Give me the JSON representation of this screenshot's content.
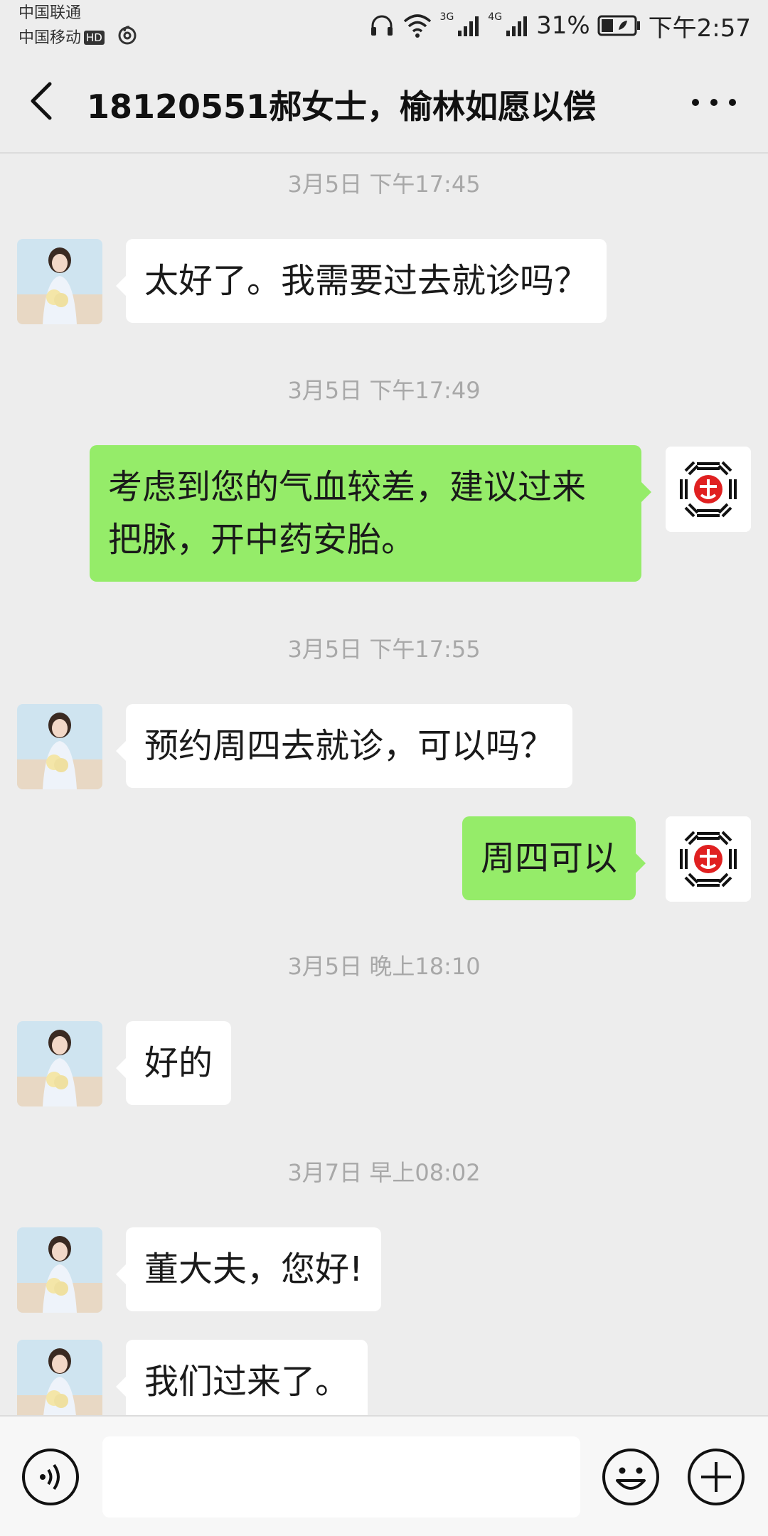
{
  "status_bar": {
    "carrier_1": "中国联通",
    "carrier_2": "中国移动",
    "hd_badge": "HD",
    "network_3g": "3G",
    "network_4g": "4G",
    "battery_percent": "31%",
    "time": "下午2:57"
  },
  "header": {
    "back_icon": "chevron-left-icon",
    "title": "18120551郝女士，榆林如愿以偿",
    "more_icon": "more-dots-icon"
  },
  "messages": [
    {
      "type": "time",
      "text": "3月5日 下午17:45"
    },
    {
      "type": "in",
      "text": "太好了。我需要过去就诊吗？"
    },
    {
      "type": "time",
      "text": "3月5日 下午17:49"
    },
    {
      "type": "out",
      "lines": [
        "考虑到您的气血较差，建议过来",
        "把脉，开中药安胎。"
      ]
    },
    {
      "type": "time",
      "text": "3月5日 下午17:55"
    },
    {
      "type": "in",
      "text": "预约周四去就诊，可以吗？"
    },
    {
      "type": "out",
      "text": "周四可以"
    },
    {
      "type": "time",
      "text": "3月5日 晚上18:10"
    },
    {
      "type": "in",
      "text": "好的"
    },
    {
      "type": "time",
      "text": "3月7日 早上08:02"
    },
    {
      "type": "in",
      "text": "董大夫，您好!"
    },
    {
      "type": "in",
      "text": "我们过来了。"
    }
  ],
  "input_bar": {
    "voice_icon": "voice-icon",
    "input_value": "",
    "emoji_icon": "emoji-icon",
    "plus_icon": "plus-icon"
  },
  "colors": {
    "background": "#ededed",
    "incoming_bubble": "#ffffff",
    "outgoing_bubble": "#95ec69",
    "timestamp_text": "#a8a8a8"
  }
}
